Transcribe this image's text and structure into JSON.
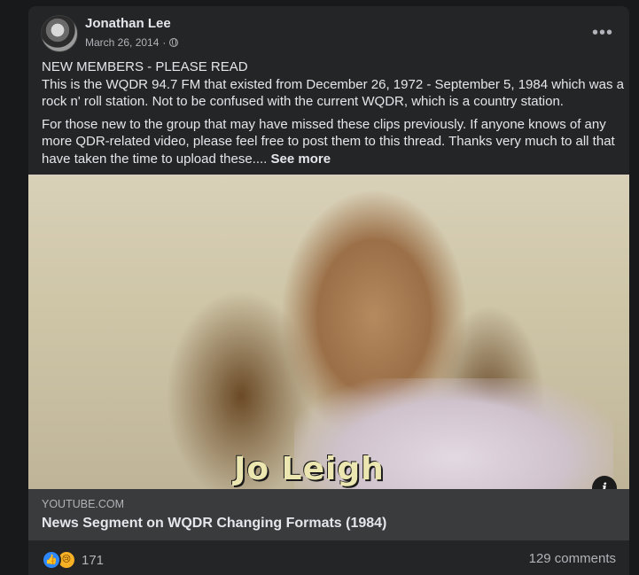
{
  "post": {
    "author": "Jonathan Lee",
    "date": "March 26, 2014",
    "separator": "·",
    "privacy_icon": "globe-icon",
    "more_label": "•••",
    "text": {
      "heading": "NEW MEMBERS - PLEASE READ",
      "line1": "This is the WQDR 94.7 FM that existed from December 26, 1972 - September 5, 1984 which was a rock n' roll station. Not to be confused with the current WQDR, which is a country station.",
      "paragraph2": "For those new to the group that may have missed these clips previously. If anyone knows of any more QDR-related video, please feel free to post them to this thread. Thanks very much to all that have taken the time to upload these....",
      "see_more": "See more"
    },
    "media": {
      "caption": "Jo Leigh",
      "info_label": "i"
    },
    "link": {
      "domain": "YOUTUBE.COM",
      "title": "News Segment on WQDR Changing Formats (1984)"
    },
    "footer": {
      "reaction_icons": [
        "like-icon",
        "sad-icon"
      ],
      "like_glyph": "👍",
      "sad_glyph": "😢",
      "reaction_count": "171",
      "comments": "129 comments"
    }
  },
  "colors": {
    "background": "#18191a",
    "card": "#242526",
    "link_box": "#3a3b3c",
    "primary_text": "#e4e6eb",
    "secondary_text": "#b0b3b8",
    "like_blue": "#2d88ff",
    "sad_yellow": "#f7b125"
  }
}
